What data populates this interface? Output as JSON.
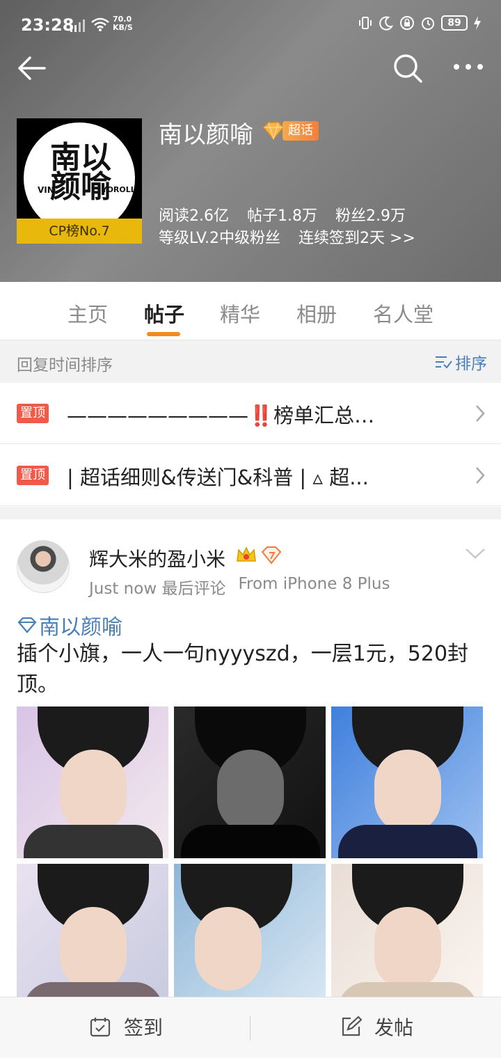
{
  "status": {
    "time": "23:28",
    "speed_value": "70.0",
    "speed_unit": "KB/S",
    "battery": "89"
  },
  "topic": {
    "name": "南以颜喻",
    "badge_label": "超话",
    "avatar_text": "南以颜喻",
    "avatar_left": "VIN",
    "avatar_right": "YOROLL",
    "cp_rank": "CP榜No.7",
    "reads": "阅读2.6亿",
    "posts": "帖子1.8万",
    "fans": "粉丝2.9万",
    "level": "等级LV.2中级粉丝",
    "checkin": "连续签到2天 >>"
  },
  "tabs": [
    "主页",
    "帖子",
    "精华",
    "相册",
    "名人堂"
  ],
  "sort": {
    "label": "回复时间排序",
    "button": "排序"
  },
  "pinned": [
    {
      "tag": "置顶",
      "text": "—————————‼️榜单汇总‼️—..."
    },
    {
      "tag": "置顶",
      "text": "| 超话细则&传送门&科普 | ▵ 超..."
    }
  ],
  "post": {
    "user": "辉大米的盈小米",
    "time": "Just now 最后评论",
    "source": "From iPhone 8 Plus",
    "topic_tag": "南以颜喻",
    "text": "插个小旗，一人一句nyyyszd，一层1元，520封顶。"
  },
  "bottom": {
    "checkin": "签到",
    "post": "发帖"
  },
  "colors": {
    "accent_orange": "#f28a1e",
    "link_blue": "#4a7fb5",
    "pin_red": "#f05a4a"
  }
}
